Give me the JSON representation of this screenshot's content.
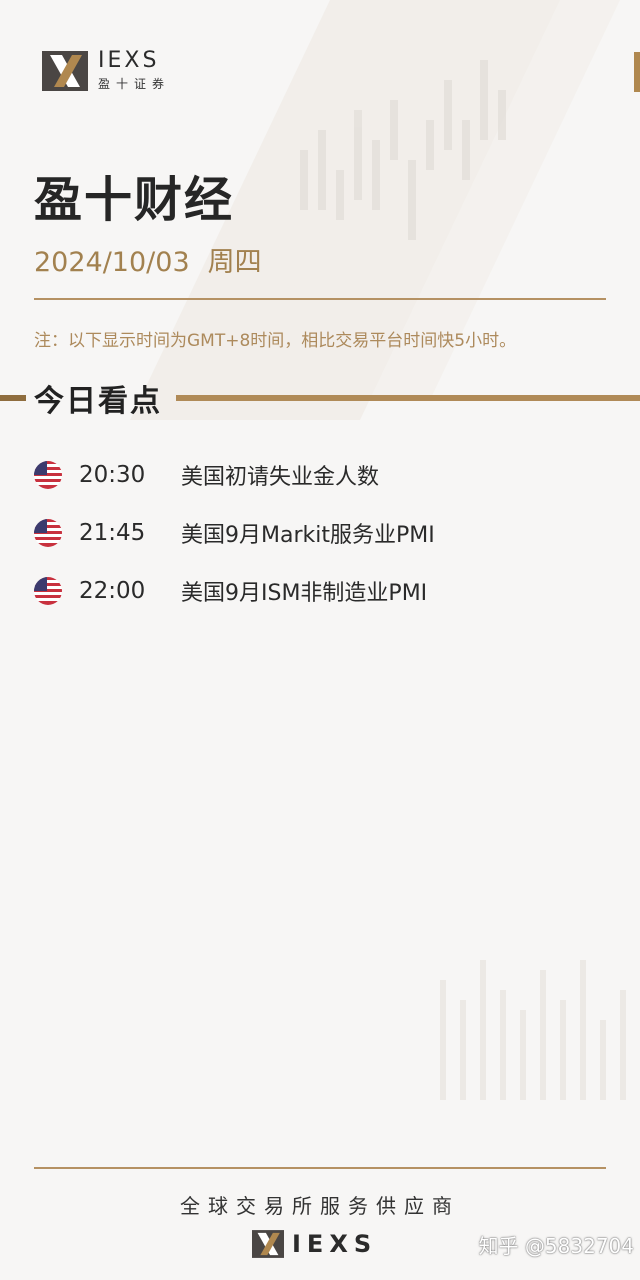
{
  "brand": {
    "name": "IEXS",
    "name_cn": "盈十证券",
    "gold": "#b0884f",
    "dark": "#2b2b2b"
  },
  "header": {
    "title": "盈十财经",
    "date": "2024/10/03",
    "weekday": "周四",
    "note": "注：以下显示时间为GMT+8时间，相比交易平台时间快5小时。"
  },
  "section": {
    "title": "今日看点"
  },
  "events": [
    {
      "flag": "us-flag-icon",
      "time": "20:30",
      "name": "美国初请失业金人数"
    },
    {
      "flag": "us-flag-icon",
      "time": "21:45",
      "name": "美国9月Markit服务业PMI"
    },
    {
      "flag": "us-flag-icon",
      "time": "22:00",
      "name": "美国9月ISM非制造业PMI"
    }
  ],
  "footer": {
    "slogan": "全球交易所服务供应商",
    "brand": "IEXS",
    "watermark": "知乎 @5832704"
  }
}
